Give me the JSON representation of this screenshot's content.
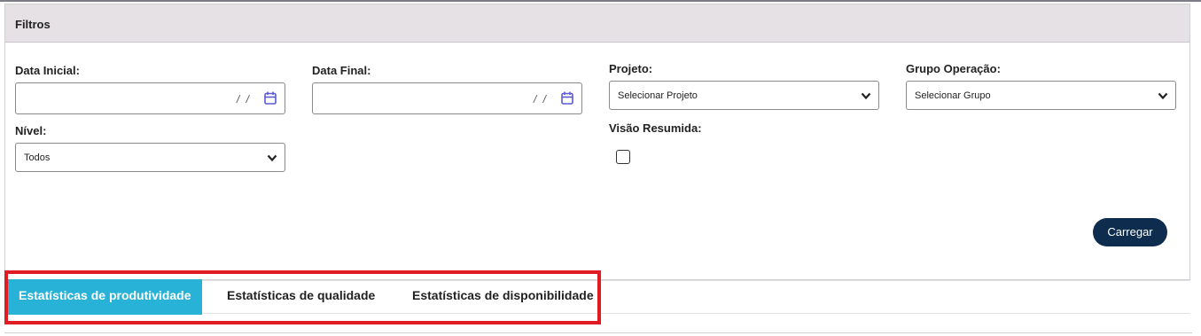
{
  "filters": {
    "title": "Filtros",
    "data_inicial": {
      "label": "Data Inicial:",
      "placeholder": "/ /"
    },
    "data_final": {
      "label": "Data Final:",
      "placeholder": "/ /"
    },
    "projeto": {
      "label": "Projeto:",
      "value": "Selecionar Projeto"
    },
    "grupo_operacao": {
      "label": "Grupo Operação:",
      "value": "Selecionar Grupo"
    },
    "nivel": {
      "label": "Nível:",
      "value": "Todos"
    },
    "visao_resumida": {
      "label": "Visão Resumida:",
      "checked": false
    },
    "load_button": "Carregar"
  },
  "tabs": [
    {
      "label": "Estatísticas de produtividade",
      "active": true
    },
    {
      "label": "Estatísticas de qualidade",
      "active": false
    },
    {
      "label": "Estatísticas de disponibilidade",
      "active": false
    }
  ],
  "icons": {
    "date_picker": "calendar-icon",
    "select_arrow": "chevron-down-icon"
  },
  "colors": {
    "header_bg": "#e5e1e5",
    "active_tab": "#29b2d8",
    "button": "#0d2c4e",
    "highlight": "#e01b24",
    "calendar_icon": "#5a5ad8"
  }
}
